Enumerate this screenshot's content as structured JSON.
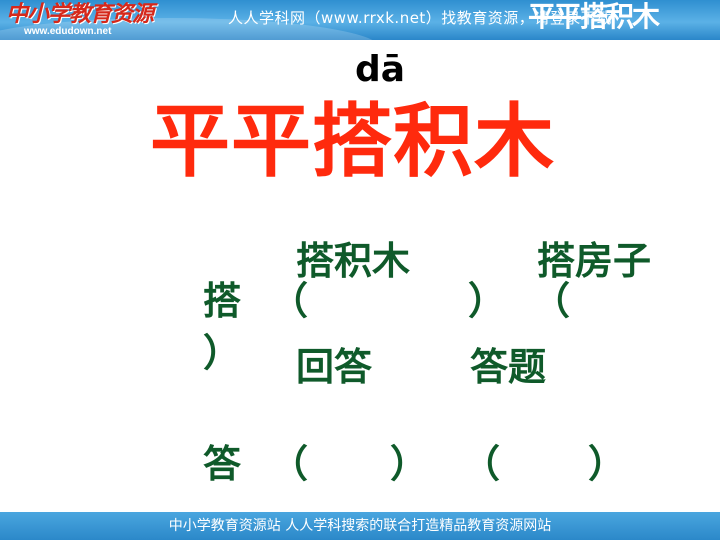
{
  "header": {
    "logo_text": "中小学教育资源",
    "logo_url": "www.edudown.net",
    "banner_text": "人人学科网（www.rrxk.net）找教育资源，请登录下载",
    "overlay_title": "平平搭积木"
  },
  "slide": {
    "pinyin": "dā",
    "title": "平平搭积木",
    "rows": [
      {
        "char": "搭",
        "open_paren_1": "（",
        "word_1": "搭积木",
        "close_paren_1": "）",
        "open_paren_2": "（",
        "word_2": "搭房子",
        "trailing_paren": "）"
      },
      {
        "word_1": "回答",
        "word_2": "答题"
      },
      {
        "char": "答",
        "open_paren_1": "（",
        "close_paren_1": "）",
        "open_paren_2": "（",
        "close_paren_2": "）"
      }
    ]
  },
  "footer": {
    "text": "中小学教育资源站 人人学科搜索的联合打造精品教育资源网站"
  }
}
